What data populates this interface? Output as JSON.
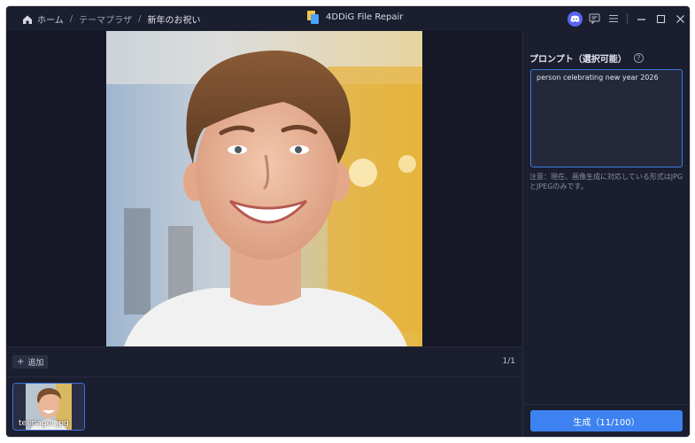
{
  "breadcrumb": {
    "home": "ホーム",
    "section": "テーマプラザ",
    "current": "新年のお祝い",
    "separator": "/"
  },
  "app": {
    "title": "4DDiG File Repair"
  },
  "toolbar": {
    "icons": [
      "discord-icon",
      "feedback-icon",
      "menu-icon",
      "minimize-icon",
      "maximize-icon",
      "close-icon"
    ]
  },
  "preview": {
    "add_label": "追加",
    "page_count": "1/1"
  },
  "thumbnails": [
    {
      "name": "teenager.jpg"
    }
  ],
  "prompt_panel": {
    "label": "プロンプト（選択可能）",
    "help_glyph": "?",
    "prompt_value": "person celebrating new year 2026",
    "note": "注意：現在、画像生成に対応している形式はJPGとJPEGのみです。",
    "generate_label": "生成（11/100）"
  },
  "colors": {
    "background": "#1b1e2e",
    "accent": "#3d82f0",
    "input_border": "#3e7be0"
  }
}
